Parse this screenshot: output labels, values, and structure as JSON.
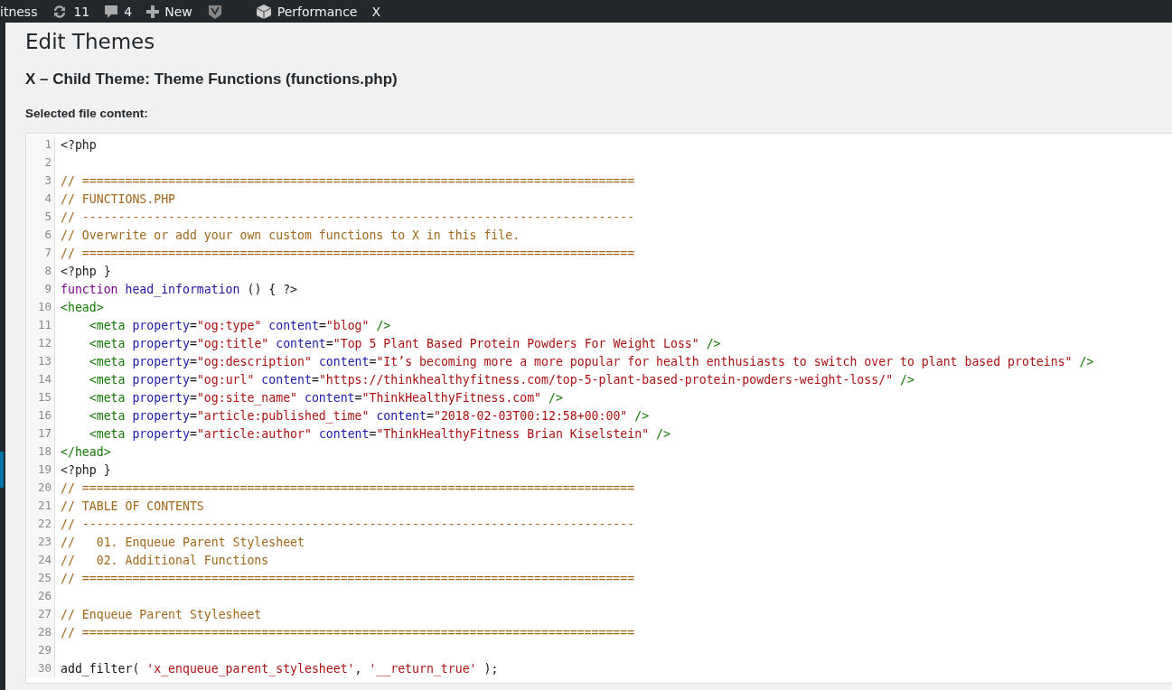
{
  "admin_bar": {
    "site_name": "itness",
    "updates_count": "11",
    "comments_count": "4",
    "new_label": "New",
    "performance_label": "Performance",
    "x_label": "X"
  },
  "page": {
    "title": "Edit Themes",
    "file_heading": "X – Child Theme: Theme Functions (functions.php)",
    "content_label": "Selected file content:"
  },
  "editor": {
    "lines": [
      {
        "number": "1",
        "tokens": [
          {
            "kind": "meta",
            "text": "<?php"
          }
        ]
      },
      {
        "number": "2"
      },
      {
        "number": "3",
        "tokens": [
          {
            "kind": "comment",
            "text": "// ============================================================================="
          }
        ]
      },
      {
        "number": "4",
        "tokens": [
          {
            "kind": "comment",
            "text": "// FUNCTIONS.PHP"
          }
        ]
      },
      {
        "number": "5",
        "tokens": [
          {
            "kind": "comment",
            "text": "// -----------------------------------------------------------------------------"
          }
        ]
      },
      {
        "number": "6",
        "tokens": [
          {
            "kind": "comment",
            "text": "// Overwrite or add your own custom functions to X in this file."
          }
        ]
      },
      {
        "number": "7",
        "tokens": [
          {
            "kind": "comment",
            "text": "// ============================================================================="
          }
        ]
      },
      {
        "number": "8",
        "tokens": [
          {
            "kind": "meta",
            "text": "<?php }"
          }
        ]
      },
      {
        "number": "9",
        "tokens": [
          {
            "kind": "keyword",
            "text": "function"
          },
          {
            "kind": "def",
            "text": " head_information"
          },
          {
            "kind": "plain",
            "text": " () { ?>"
          }
        ]
      },
      {
        "number": "10",
        "tokens": [
          {
            "kind": "tag",
            "text": "<head>"
          }
        ]
      },
      {
        "number": "11",
        "tokens": [
          {
            "kind": "tag",
            "text": "    <meta"
          },
          {
            "kind": "attr",
            "text": " property"
          },
          {
            "kind": "plain",
            "text": "="
          },
          {
            "kind": "string",
            "text": "\"og:type\""
          },
          {
            "kind": "attr",
            "text": " content"
          },
          {
            "kind": "plain",
            "text": "="
          },
          {
            "kind": "string",
            "text": "\"blog\""
          },
          {
            "kind": "tag",
            "text": " />"
          }
        ]
      },
      {
        "number": "12",
        "tokens": [
          {
            "kind": "tag",
            "text": "    <meta"
          },
          {
            "kind": "attr",
            "text": " property"
          },
          {
            "kind": "plain",
            "text": "="
          },
          {
            "kind": "string",
            "text": "\"og:title\""
          },
          {
            "kind": "attr",
            "text": " content"
          },
          {
            "kind": "plain",
            "text": "="
          },
          {
            "kind": "string",
            "text": "\"Top 5 Plant Based Protein Powders For Weight Loss\""
          },
          {
            "kind": "tag",
            "text": " />"
          }
        ]
      },
      {
        "number": "13",
        "tokens": [
          {
            "kind": "tag",
            "text": "    <meta"
          },
          {
            "kind": "attr",
            "text": " property"
          },
          {
            "kind": "plain",
            "text": "="
          },
          {
            "kind": "string",
            "text": "\"og:description\""
          },
          {
            "kind": "attr",
            "text": " content"
          },
          {
            "kind": "plain",
            "text": "="
          },
          {
            "kind": "string",
            "text": "\"It’s becoming more a more popular for health enthusiasts to switch over to plant based proteins\""
          },
          {
            "kind": "tag",
            "text": " />"
          }
        ]
      },
      {
        "number": "14",
        "tokens": [
          {
            "kind": "tag",
            "text": "    <meta"
          },
          {
            "kind": "attr",
            "text": " property"
          },
          {
            "kind": "plain",
            "text": "="
          },
          {
            "kind": "string",
            "text": "\"og:url\""
          },
          {
            "kind": "attr",
            "text": " content"
          },
          {
            "kind": "plain",
            "text": "="
          },
          {
            "kind": "string",
            "text": "\"https://thinkhealthyfitness.com/top-5-plant-based-protein-powders-weight-loss/\""
          },
          {
            "kind": "tag",
            "text": " />"
          }
        ]
      },
      {
        "number": "15",
        "tokens": [
          {
            "kind": "tag",
            "text": "    <meta"
          },
          {
            "kind": "attr",
            "text": " property"
          },
          {
            "kind": "plain",
            "text": "="
          },
          {
            "kind": "string",
            "text": "\"og:site_name\""
          },
          {
            "kind": "attr",
            "text": " content"
          },
          {
            "kind": "plain",
            "text": "="
          },
          {
            "kind": "string",
            "text": "\"ThinkHealthyFitness.com\""
          },
          {
            "kind": "tag",
            "text": " />"
          }
        ]
      },
      {
        "number": "16",
        "tokens": [
          {
            "kind": "tag",
            "text": "    <meta"
          },
          {
            "kind": "attr",
            "text": " property"
          },
          {
            "kind": "plain",
            "text": "="
          },
          {
            "kind": "string",
            "text": "\"article:published_time\""
          },
          {
            "kind": "attr",
            "text": " content"
          },
          {
            "kind": "plain",
            "text": "="
          },
          {
            "kind": "string",
            "text": "\"2018-02-03T00:12:58+00:00\""
          },
          {
            "kind": "tag",
            "text": " />"
          }
        ]
      },
      {
        "number": "17",
        "tokens": [
          {
            "kind": "tag",
            "text": "    <meta"
          },
          {
            "kind": "attr",
            "text": " property"
          },
          {
            "kind": "plain",
            "text": "="
          },
          {
            "kind": "string",
            "text": "\"article:author\""
          },
          {
            "kind": "attr",
            "text": " content"
          },
          {
            "kind": "plain",
            "text": "="
          },
          {
            "kind": "string",
            "text": "\"ThinkHealthyFitness Brian Kiselstein\""
          },
          {
            "kind": "tag",
            "text": " />"
          }
        ]
      },
      {
        "number": "18",
        "tokens": [
          {
            "kind": "tag",
            "text": "</head>"
          }
        ]
      },
      {
        "number": "19",
        "tokens": [
          {
            "kind": "meta",
            "text": "<?php }"
          }
        ]
      },
      {
        "number": "20",
        "tokens": [
          {
            "kind": "comment",
            "text": "// ============================================================================="
          }
        ]
      },
      {
        "number": "21",
        "tokens": [
          {
            "kind": "comment",
            "text": "// TABLE OF CONTENTS"
          }
        ]
      },
      {
        "number": "22",
        "tokens": [
          {
            "kind": "comment",
            "text": "// -----------------------------------------------------------------------------"
          }
        ]
      },
      {
        "number": "23",
        "tokens": [
          {
            "kind": "comment",
            "text": "//   01. Enqueue Parent Stylesheet"
          }
        ]
      },
      {
        "number": "24",
        "tokens": [
          {
            "kind": "comment",
            "text": "//   02. Additional Functions"
          }
        ]
      },
      {
        "number": "25",
        "tokens": [
          {
            "kind": "comment",
            "text": "// ============================================================================="
          }
        ]
      },
      {
        "number": "26"
      },
      {
        "number": "27",
        "tokens": [
          {
            "kind": "comment",
            "text": "// Enqueue Parent Stylesheet"
          }
        ]
      },
      {
        "number": "28",
        "tokens": [
          {
            "kind": "comment",
            "text": "// ============================================================================="
          }
        ]
      },
      {
        "number": "29"
      },
      {
        "number": "30",
        "tokens": [
          {
            "kind": "plain",
            "text": "add_filter( "
          },
          {
            "kind": "string",
            "text": "'x_enqueue_parent_stylesheet'"
          },
          {
            "kind": "plain",
            "text": ", "
          },
          {
            "kind": "string",
            "text": "'__return_true'"
          },
          {
            "kind": "plain",
            "text": " );"
          }
        ]
      }
    ]
  }
}
